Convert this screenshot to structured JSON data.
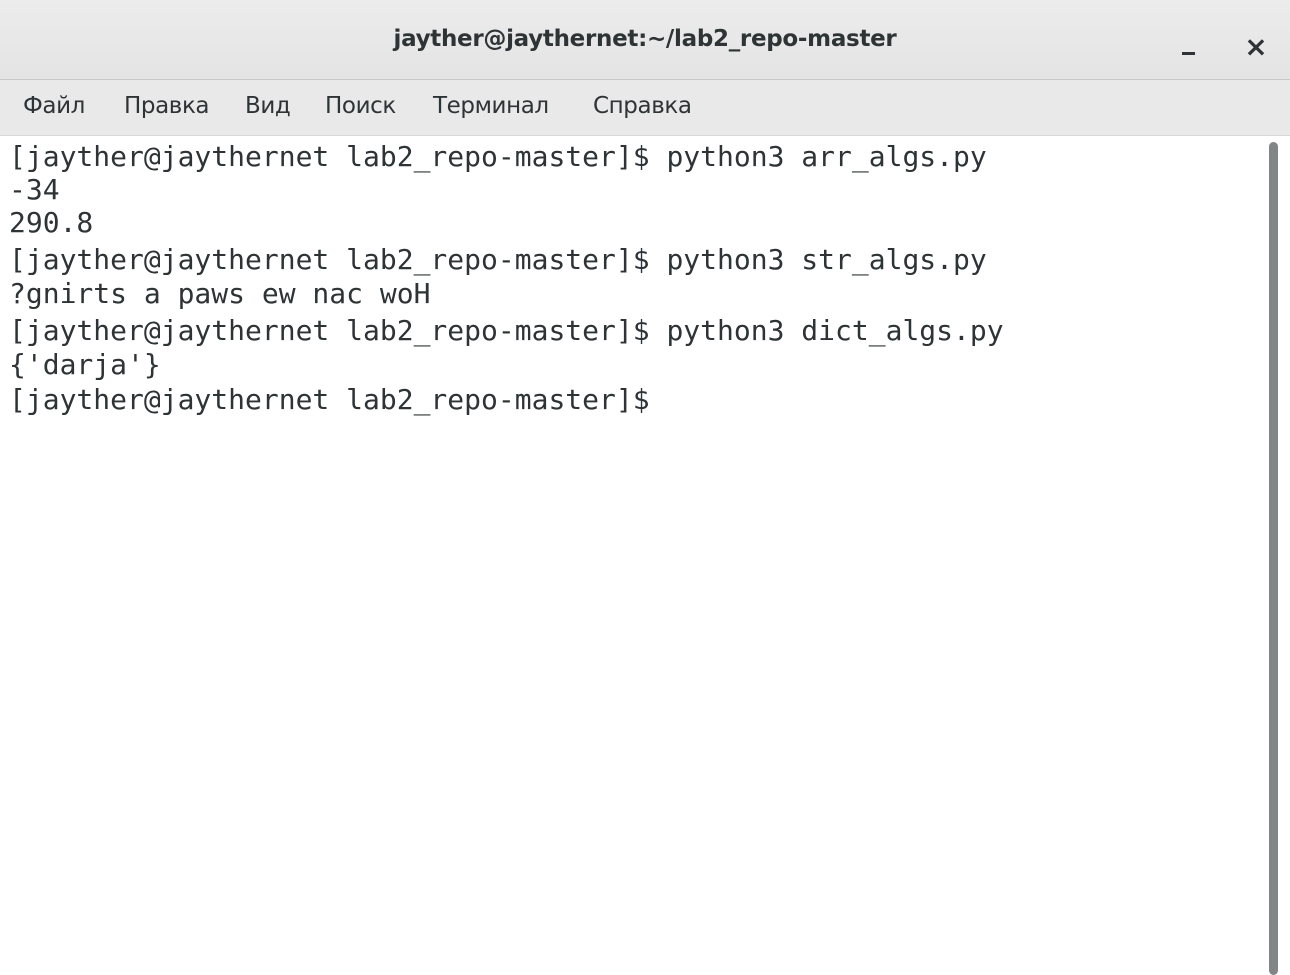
{
  "window": {
    "title": "jayther@jaythernet:~/lab2_repo-master",
    "minimize_icon": "minimize-icon",
    "close_icon": "close-icon",
    "close_glyph": "×"
  },
  "menubar": {
    "items": [
      {
        "label": "Файл"
      },
      {
        "label": "Правка"
      },
      {
        "label": "Вид"
      },
      {
        "label": "Поиск"
      },
      {
        "label": "Терминал"
      },
      {
        "label": "Справка"
      }
    ]
  },
  "terminal": {
    "lines": [
      "[jayther@jaythernet lab2_repo-master]$ python3 arr_algs.py",
      "-34",
      "290.8",
      "[jayther@jaythernet lab2_repo-master]$ python3 str_algs.py",
      "?gnirts a paws ew nac woH",
      "[jayther@jaythernet lab2_repo-master]$ python3 dict_algs.py",
      "{'darja'}",
      "[jayther@jaythernet lab2_repo-master]$"
    ]
  },
  "colors": {
    "text": "#2e3436",
    "background": "#ffffff",
    "scrollbar_thumb": "#828585"
  }
}
